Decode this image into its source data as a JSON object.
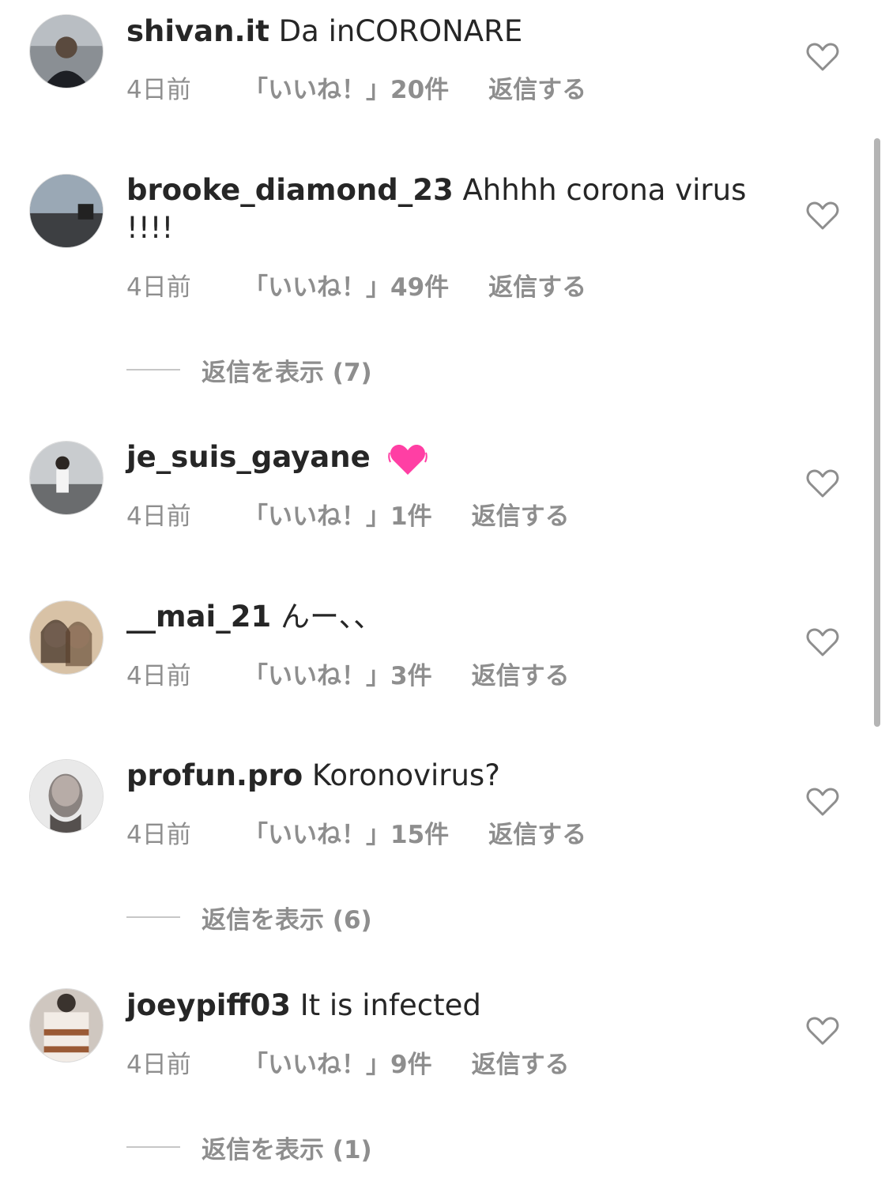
{
  "comments": [
    {
      "username": "shivan.it",
      "text": "Da inCORONARE",
      "time": "4日前",
      "likes": "「いいね！」20件",
      "reply": "返信する"
    },
    {
      "username": "brooke_diamond_23",
      "text": "Ahhhh corona virus !!!!",
      "time": "4日前",
      "likes": "「いいね！」49件",
      "reply": "返信する",
      "view_replies": "返信を表示 (7)"
    },
    {
      "username": "je_suis_gayane",
      "text": "",
      "emoji": "beating-heart-icon",
      "time": "4日前",
      "likes": "「いいね！」1件",
      "reply": "返信する"
    },
    {
      "username": "__mai_21",
      "text": "んー、、",
      "time": "4日前",
      "likes": "「いいね！」3件",
      "reply": "返信する"
    },
    {
      "username": "profun.pro",
      "text": "Koronovirus?",
      "time": "4日前",
      "likes": "「いいね！」15件",
      "reply": "返信する",
      "view_replies": "返信を表示 (6)"
    },
    {
      "username": "joeypiff03",
      "text": "It is infected",
      "time": "4日前",
      "likes": "「いいね！」9件",
      "reply": "返信する",
      "view_replies": "返信を表示 (1)"
    }
  ],
  "colors": {
    "text": "#262626",
    "meta": "#8e8e8e",
    "emoji_heart": "#ff3fa4"
  }
}
